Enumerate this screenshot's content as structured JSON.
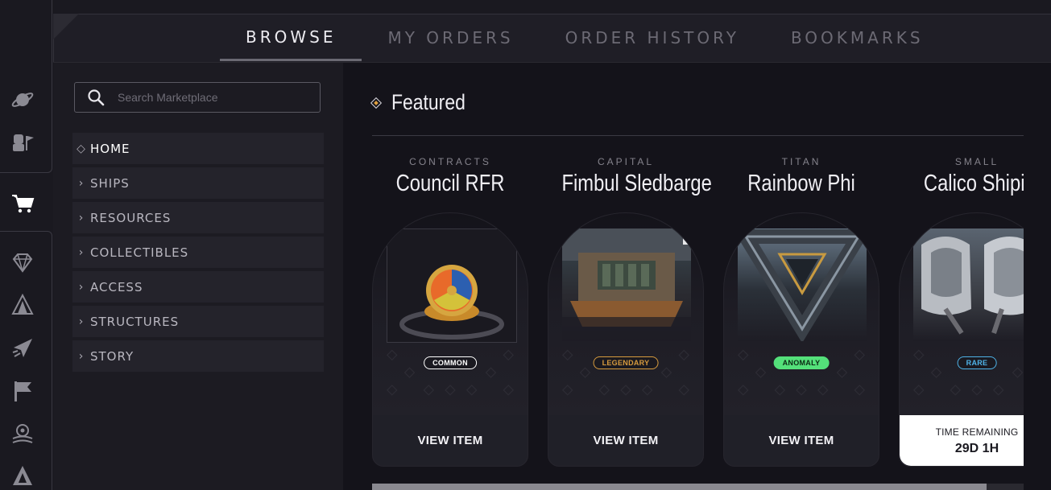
{
  "tabs": [
    {
      "label": "BROWSE",
      "active": true
    },
    {
      "label": "MY ORDERS",
      "active": false
    },
    {
      "label": "ORDER HISTORY",
      "active": false
    },
    {
      "label": "BOOKMARKS",
      "active": false
    }
  ],
  "rail_icons": [
    "planet-icon",
    "npc-icon",
    "cart-icon",
    "gem-icon",
    "tent-icon",
    "ship-icon",
    "flag-icon",
    "galaxy-icon",
    "faction-icon"
  ],
  "search": {
    "placeholder": "Search Marketplace"
  },
  "nav": [
    {
      "label": "HOME",
      "active": true
    },
    {
      "label": "SHIPS"
    },
    {
      "label": "RESOURCES"
    },
    {
      "label": "COLLECTIBLES"
    },
    {
      "label": "ACCESS"
    },
    {
      "label": "STRUCTURES"
    },
    {
      "label": "STORY"
    }
  ],
  "featured": {
    "title": "Featured",
    "cards": [
      {
        "category": "CONTRACTS",
        "name": "Council RFR",
        "rarity": "COMMON",
        "button": "VIEW ITEM"
      },
      {
        "category": "CAPITAL",
        "name": "Fimbul Sledbarge",
        "rarity": "LEGENDARY",
        "button": "VIEW ITEM"
      },
      {
        "category": "TITAN",
        "name": "Rainbow Phi",
        "rarity": "ANOMALY",
        "button": "VIEW ITEM"
      },
      {
        "category": "SMALL",
        "name": "Calico Shipit",
        "rarity": "RARE",
        "time_label": "TIME REMAINING",
        "time_value": "29D 1H"
      }
    ]
  },
  "colors": {
    "common": "#ffffff",
    "legendary": "#d79b3e",
    "anomaly": "#54e07a",
    "rare": "#4fb3e8",
    "accent": "#e0a040"
  }
}
